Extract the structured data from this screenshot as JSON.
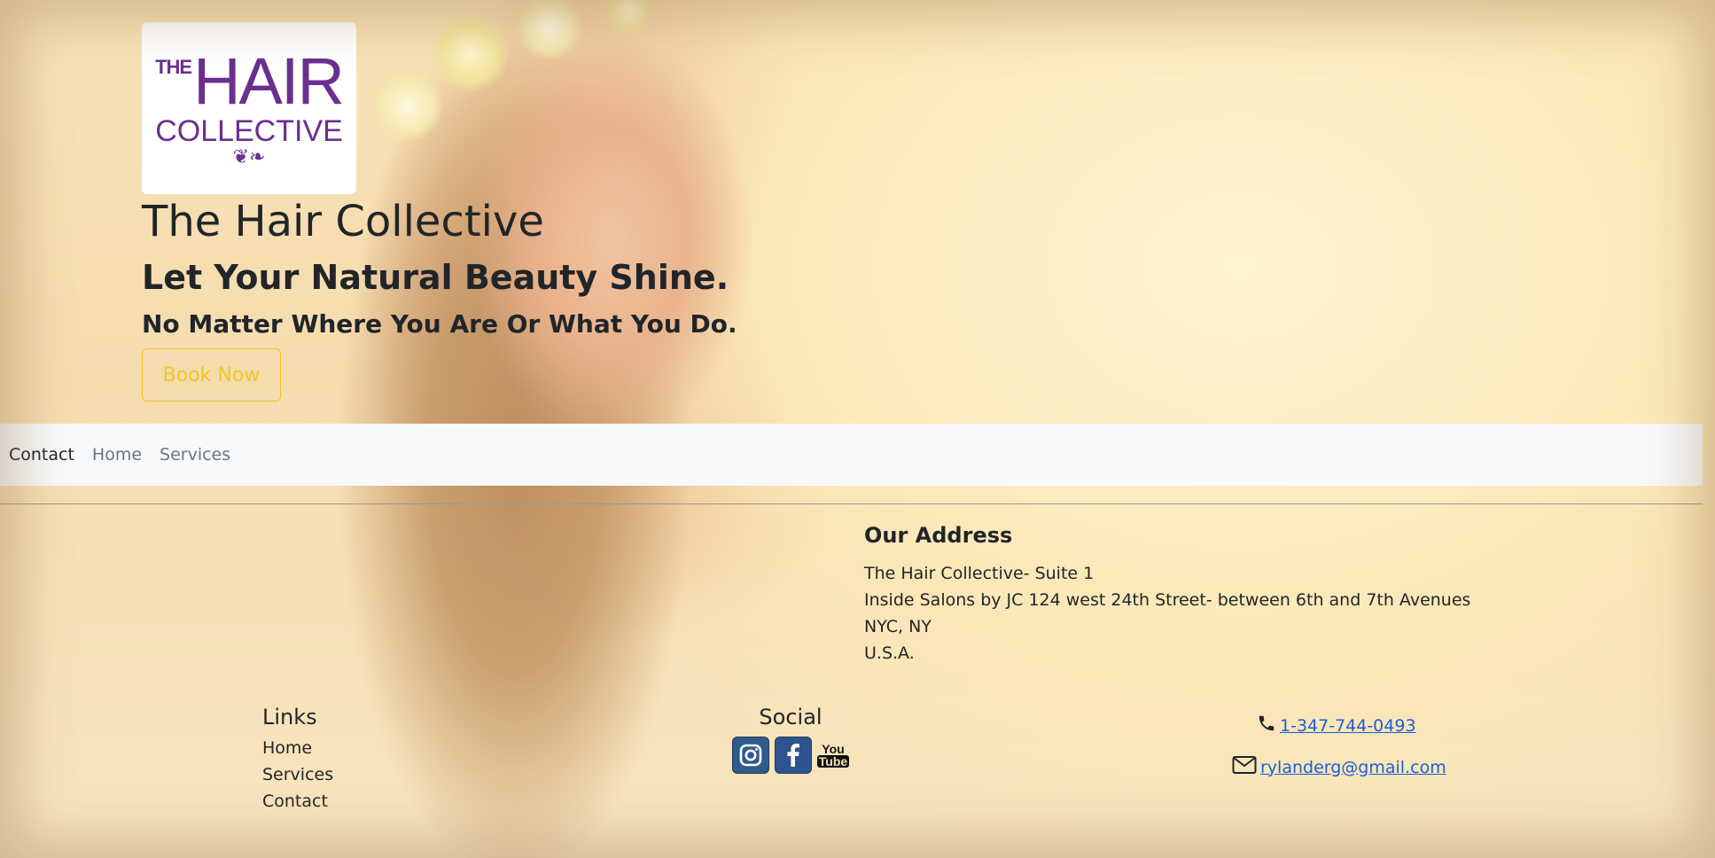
{
  "hero": {
    "logo": {
      "the": "THE",
      "hair": "HAIR",
      "collective": "COLLECTIVE"
    },
    "title": "The Hair Collective",
    "tagline": "Let Your Natural Beauty Shine.",
    "subtitle": "No Matter Where You Are Or What You Do.",
    "book_button": "Book Now",
    "button_color": "#f3c623"
  },
  "navbar": {
    "items": [
      {
        "label": "Contact",
        "active": true
      },
      {
        "label": "Home",
        "active": false
      },
      {
        "label": "Services",
        "active": false
      }
    ]
  },
  "address": {
    "heading": "Our Address",
    "lines": [
      "The Hair Collective- Suite 1",
      "Inside Salons by JC 124 west 24th Street- between 6th and 7th Avenues",
      "NYC, NY",
      "U.S.A."
    ]
  },
  "links": {
    "heading": "Links",
    "items": [
      "Home",
      "Services",
      "Contact"
    ]
  },
  "social": {
    "heading": "Social",
    "icons": [
      "instagram-icon",
      "facebook-icon",
      "youtube-icon"
    ],
    "youtube": {
      "you": "You",
      "tube": "Tube"
    }
  },
  "contact": {
    "phone": " 1-347-744-0493",
    "email": " rylanderg@gmail.com",
    "link_color": "#1a5ed8"
  }
}
